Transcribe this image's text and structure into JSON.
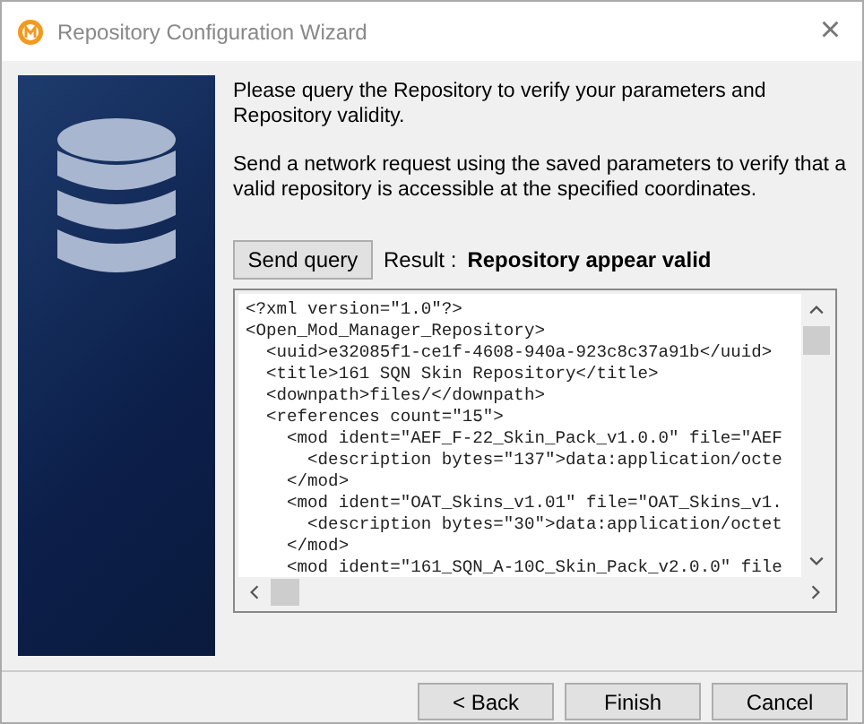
{
  "window": {
    "title": "Repository Configuration Wizard",
    "close": "×"
  },
  "intro": [
    "Please query the Repository to verify your parameters and Repository validity.",
    "Send a network request using the saved parameters to verify that a valid repository is accessible at the specified coordinates."
  ],
  "query": {
    "button": "Send query",
    "result_label": "Result :",
    "result": "Repository appear valid"
  },
  "response_lines": [
    "<?xml version=\"1.0\"?>",
    "<Open_Mod_Manager_Repository>",
    "  <uuid>e32085f1-ce1f-4608-940a-923c8c37a91b</uuid>",
    "  <title>161 SQN Skin Repository</title>",
    "  <downpath>files/</downpath>",
    "  <references count=\"15\">",
    "    <mod ident=\"AEF_F-22_Skin_Pack_v1.0.0\" file=\"AEF",
    "      <description bytes=\"137\">data:application/octe",
    "    </mod>",
    "    <mod ident=\"OAT_Skins_v1.01\" file=\"OAT_Skins_v1.",
    "      <description bytes=\"30\">data:application/octet",
    "    </mod>",
    "    <mod ident=\"161_SQN_A-10C_Skin_Pack_v2.0.0\" file"
  ],
  "buttons": [
    {
      "label": "< Back"
    },
    {
      "label": "Finish"
    },
    {
      "label": "Cancel"
    }
  ]
}
